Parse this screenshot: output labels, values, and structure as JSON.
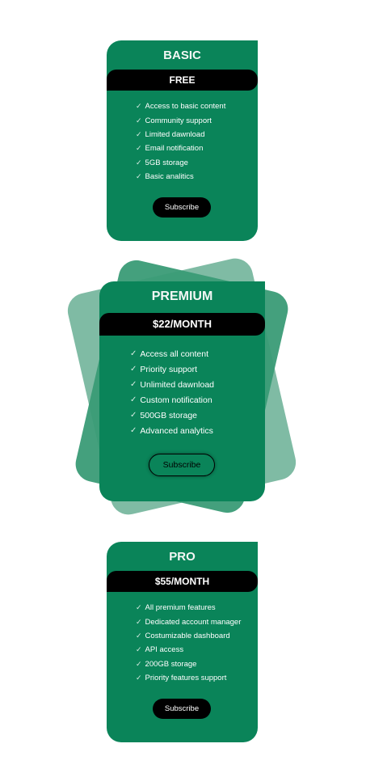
{
  "colors": {
    "card_green": "#0a8459",
    "band_black": "#000000",
    "deco_light": "#7fbba4",
    "deco_mid": "#3a9b76"
  },
  "check_icon": "✓",
  "plans": {
    "basic": {
      "title": "BASIC",
      "price": "FREE",
      "features": [
        "Access to basic content",
        "Community support",
        "Limited dawnload",
        "Email notification",
        "5GB storage",
        "Basic analitics"
      ],
      "cta": "Subscribe"
    },
    "premium": {
      "title": "PREMIUM",
      "price": "$22/MONTH",
      "features": [
        "Access all content",
        "Priority support",
        "Unlimited dawnload",
        "Custom notification",
        "500GB storage",
        "Advanced analytics"
      ],
      "cta": "Subscribe"
    },
    "pro": {
      "title": "PRO",
      "price": "$55/MONTH",
      "features": [
        "All premium features",
        "Dedicated account manager",
        "Costumizable dashboard",
        "API access",
        "200GB storage",
        "Priority features support"
      ],
      "cta": "Subscribe"
    }
  }
}
